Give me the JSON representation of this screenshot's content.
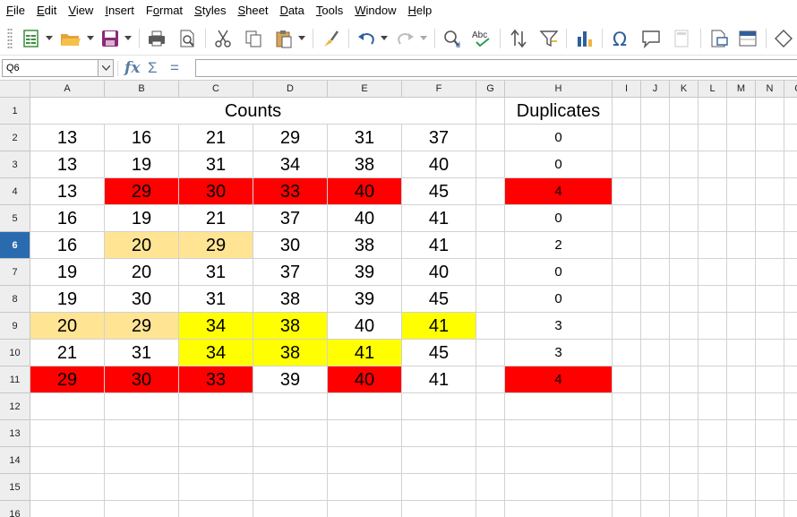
{
  "menu": [
    "File",
    "Edit",
    "View",
    "Insert",
    "Format",
    "Styles",
    "Sheet",
    "Data",
    "Tools",
    "Window",
    "Help"
  ],
  "menu_underline_index": [
    0,
    0,
    0,
    0,
    1,
    0,
    0,
    0,
    0,
    0,
    0
  ],
  "toolbar": {
    "icons": [
      "new-spreadsheet-icon",
      "dropdown-icon",
      "open-folder-icon",
      "dropdown-icon",
      "save-icon",
      "dropdown-icon",
      "print-icon",
      "print-preview-icon",
      "cut-icon",
      "copy-icon",
      "paste-icon",
      "dropdown-icon",
      "clone-formatting-icon",
      "undo-icon",
      "dropdown-icon",
      "redo-icon",
      "dropdown-icon",
      "find-replace-icon",
      "spelling-icon",
      "sort-icon",
      "autofilter-icon",
      "chart-icon",
      "special-character-icon",
      "comment-icon",
      "headers-footers-icon",
      "define-print-area-icon",
      "freeze-rows-columns-icon",
      "draw-shapes-icon"
    ]
  },
  "formula_bar": {
    "name_box": "Q6",
    "formula": "",
    "fx": "fx",
    "sum": "Σ",
    "equals": "="
  },
  "columns": [
    "A",
    "B",
    "C",
    "D",
    "E",
    "F",
    "G",
    "H",
    "I",
    "J",
    "K",
    "L",
    "M",
    "N",
    "O"
  ],
  "rows": [
    "1",
    "2",
    "3",
    "4",
    "5",
    "6",
    "7",
    "8",
    "9",
    "10",
    "11",
    "12",
    "13",
    "14",
    "15",
    "16"
  ],
  "active_row": "6",
  "headers": {
    "counts": "Counts",
    "duplicates": "Duplicates"
  },
  "data": [
    [
      "13",
      "16",
      "21",
      "29",
      "31",
      "37"
    ],
    [
      "13",
      "19",
      "31",
      "34",
      "38",
      "40"
    ],
    [
      "13",
      "29",
      "30",
      "33",
      "40",
      "45"
    ],
    [
      "16",
      "19",
      "21",
      "37",
      "40",
      "41"
    ],
    [
      "16",
      "20",
      "29",
      "30",
      "38",
      "41"
    ],
    [
      "19",
      "20",
      "31",
      "37",
      "39",
      "40"
    ],
    [
      "19",
      "30",
      "31",
      "38",
      "39",
      "45"
    ],
    [
      "20",
      "29",
      "34",
      "38",
      "40",
      "41"
    ],
    [
      "21",
      "31",
      "34",
      "38",
      "41",
      "45"
    ],
    [
      "29",
      "30",
      "33",
      "39",
      "40",
      "41"
    ]
  ],
  "duplicates": [
    "0",
    "0",
    "4",
    "0",
    "2",
    "0",
    "0",
    "3",
    "3",
    "4"
  ],
  "highlight": [
    [
      "",
      "",
      "",
      "",
      "",
      ""
    ],
    [
      "",
      "",
      "",
      "",
      "",
      ""
    ],
    [
      "",
      "red",
      "red",
      "red",
      "red",
      ""
    ],
    [
      "",
      "",
      "",
      "",
      "",
      ""
    ],
    [
      "",
      "tan",
      "tan",
      "",
      "",
      ""
    ],
    [
      "",
      "",
      "",
      "",
      "",
      ""
    ],
    [
      "",
      "",
      "",
      "",
      "",
      ""
    ],
    [
      "tan",
      "tan",
      "yellow",
      "yellow",
      "",
      "yellow"
    ],
    [
      "",
      "",
      "yellow",
      "yellow",
      "yellow",
      ""
    ],
    [
      "red",
      "red",
      "red",
      "",
      "red",
      ""
    ]
  ],
  "duplicates_highlight": [
    "",
    "",
    "red",
    "",
    "",
    "",
    "",
    "",
    "",
    "red"
  ],
  "colors": {
    "red": "#ff0000",
    "yellow": "#ffff00",
    "tan": "#ffe494",
    "active_header": "#2a6bb0"
  }
}
